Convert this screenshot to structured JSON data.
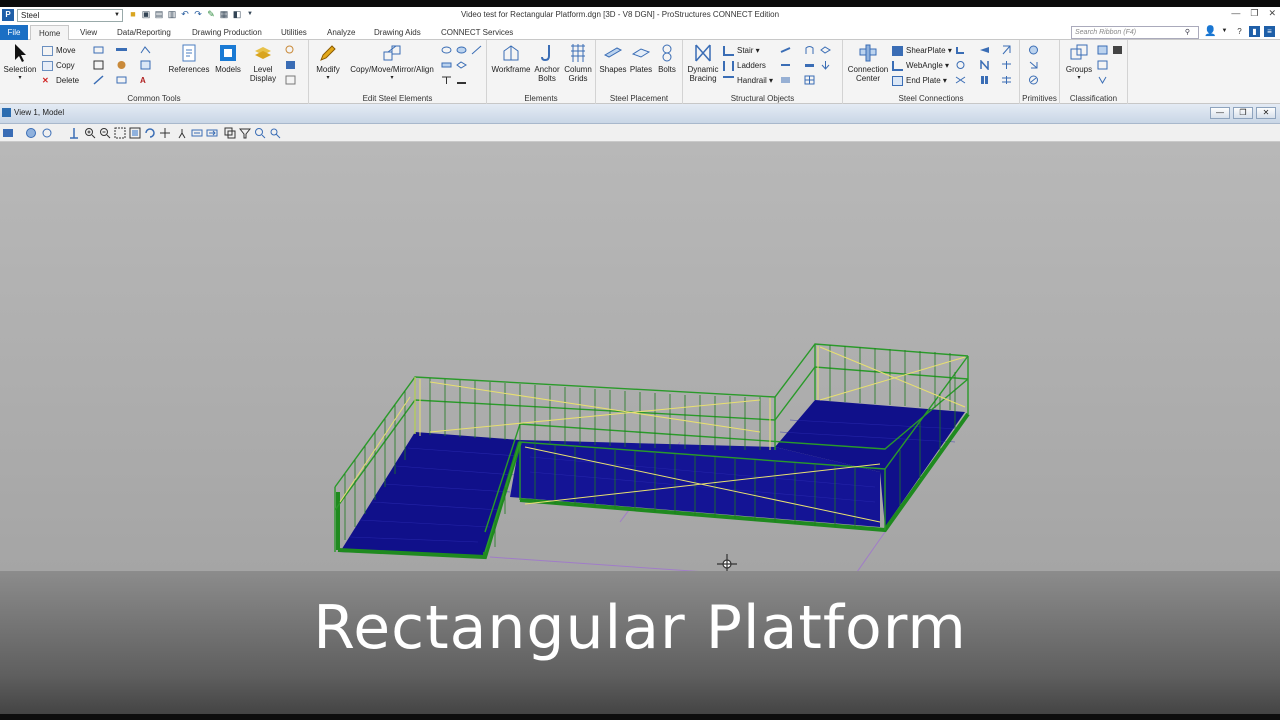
{
  "titlebar": {
    "workspace": "Steel",
    "window_title": "Video test for Rectangular Platform.dgn [3D - V8 DGN] - ProStructures CONNECT Edition"
  },
  "tabs": [
    "File",
    "Home",
    "View",
    "Data/Reporting",
    "Drawing Production",
    "Utilities",
    "Analyze",
    "Drawing Aids",
    "CONNECT Services"
  ],
  "search": {
    "placeholder": "Search Ribbon (F4)"
  },
  "ribbon": {
    "common_tools": {
      "label": "Common Tools",
      "selection": "Selection",
      "move": "Move",
      "copy": "Copy",
      "delete": "Delete",
      "references": "References",
      "models": "Models",
      "level_display_1": "Level",
      "level_display_2": "Display"
    },
    "edit_steel": {
      "label": "Edit Steel Elements",
      "modify": "Modify",
      "copy_move": "Copy/Move/Mirror/Align"
    },
    "elements": {
      "label": "Elements",
      "workframe": "Workframe",
      "anchor_1": "Anchor",
      "anchor_2": "Bolts",
      "column_1": "Column",
      "column_2": "Grids"
    },
    "steel_placement": {
      "label": "Steel Placement",
      "shapes": "Shapes",
      "plates": "Plates",
      "bolts": "Bolts"
    },
    "structural_objects": {
      "label": "Structural Objects",
      "dynamic_1": "Dynamic",
      "dynamic_2": "Bracing",
      "stair": "Stair",
      "ladders": "Ladders",
      "handrail": "Handrail"
    },
    "steel_connections": {
      "label": "Steel Connections",
      "connection_1": "Connection",
      "connection_2": "Center",
      "shearplate": "ShearPlate",
      "webangle": "WebAngle",
      "endplate": "End Plate"
    },
    "primitives": {
      "label": "Primitives"
    },
    "classification": {
      "label": "Classification",
      "groups": "Groups"
    }
  },
  "view": {
    "title": "View 1, Model"
  },
  "caption": "Rectangular Platform",
  "colors": {
    "file_tab": "#1a6fc4",
    "deck": "#10108a",
    "steel": "#1f8a1f",
    "railing_highlight": "#e8e070",
    "construction_line": "#a07cc8"
  }
}
